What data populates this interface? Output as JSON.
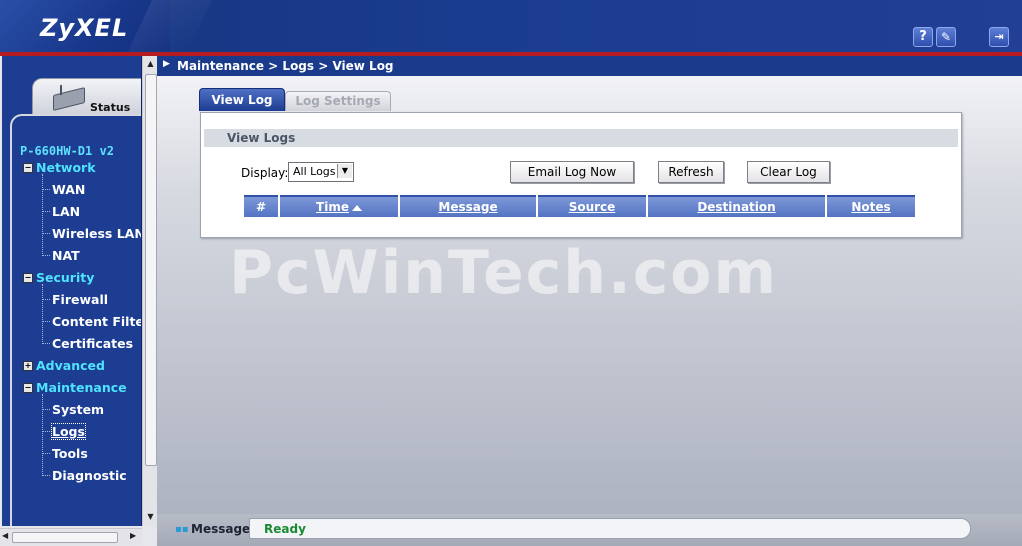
{
  "header": {
    "logo": "ZyXEL",
    "help_icon": "?",
    "wizard_icon": "✎",
    "logout_icon": "⇥"
  },
  "sidebar": {
    "status_label": "Status",
    "model": "P-660HW-D1 v2",
    "categories": [
      {
        "label": "Network",
        "expander": "−",
        "items": [
          "WAN",
          "LAN",
          "Wireless LAN",
          "NAT"
        ]
      },
      {
        "label": "Security",
        "expander": "−",
        "items": [
          "Firewall",
          "Content Filter",
          "Certificates"
        ]
      },
      {
        "label": "Advanced",
        "expander": "+",
        "items": []
      },
      {
        "label": "Maintenance",
        "expander": "−",
        "items": [
          "System",
          "Logs",
          "Tools",
          "Diagnostic"
        ]
      }
    ],
    "selected_item": "Logs"
  },
  "main": {
    "breadcrumb": "Maintenance > Logs > View Log",
    "tabs": [
      {
        "label": "View Log",
        "active": true
      },
      {
        "label": "Log Settings",
        "active": false
      }
    ],
    "panel_title": "View Logs",
    "display_label": "Display:",
    "display_value": "All Logs",
    "buttons": {
      "email": "Email Log Now",
      "refresh": "Refresh",
      "clear": "Clear Log"
    },
    "table_columns": [
      "#",
      "Time",
      "Message",
      "Source",
      "Destination",
      "Notes"
    ],
    "watermark": "PcWinTech.com"
  },
  "statusbar": {
    "label": "Message",
    "text": "Ready"
  },
  "colors": {
    "header_blue": "#1a3c8e",
    "accent_red": "#b41c22",
    "nav_cyan": "#4fe3ff",
    "ready_green": "#1a8a32"
  }
}
